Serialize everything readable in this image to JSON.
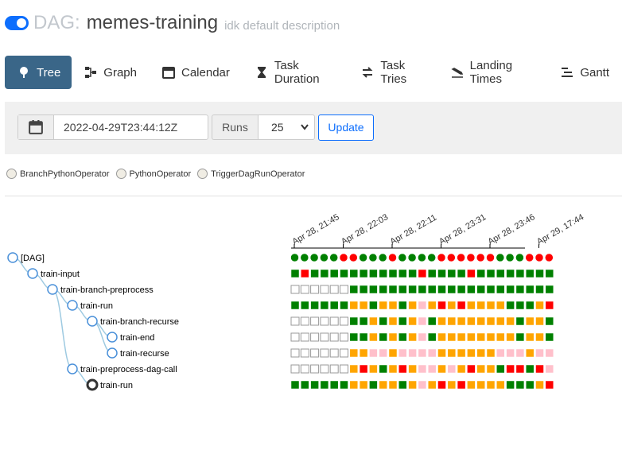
{
  "header": {
    "dag_prefix": "DAG:",
    "dag_id": "memes-training",
    "description": "idk default description",
    "toggle_on": true
  },
  "tabs": [
    {
      "label": "Tree",
      "icon": "tree-icon",
      "active": true
    },
    {
      "label": "Graph",
      "icon": "graph-icon"
    },
    {
      "label": "Calendar",
      "icon": "calendar-icon"
    },
    {
      "label": "Task Duration",
      "icon": "hourglass-icon"
    },
    {
      "label": "Task Tries",
      "icon": "retry-icon"
    },
    {
      "label": "Landing Times",
      "icon": "landing-icon"
    },
    {
      "label": "Gantt",
      "icon": "gantt-icon"
    }
  ],
  "toolbar": {
    "base_date": "2022-04-29T23:44:12Z",
    "runs_label": "Runs",
    "runs_value": "25",
    "update_label": "Update"
  },
  "legend": [
    "BranchPythonOperator",
    "PythonOperator",
    "TriggerDagRunOperator"
  ],
  "colors": {
    "success": "#008000",
    "failed": "#ff0000",
    "upstream_failed": "#ffa500",
    "skipped": "#ffc0cb",
    "none": "#ffffff",
    "accent": "#0d6efd",
    "active_tab": "#3a6688"
  },
  "run_dates": [
    "Apr 28, 21:45",
    "Apr 28, 22:03",
    "Apr 28, 22:11",
    "Apr 28, 23:31",
    "Apr 28, 23:46",
    "Apr 29, 17:44"
  ],
  "tree": [
    {
      "label": "[DAG]",
      "depth": 0
    },
    {
      "label": "train-input",
      "depth": 1
    },
    {
      "label": "train-branch-preprocess",
      "depth": 2
    },
    {
      "label": "train-run",
      "depth": 3
    },
    {
      "label": "train-branch-recurse",
      "depth": 4
    },
    {
      "label": "train-end",
      "depth": 5
    },
    {
      "label": "train-recurse",
      "depth": 5
    },
    {
      "label": "train-preprocess-dag-call",
      "depth": 3
    },
    {
      "label": "train-run",
      "depth": 4
    }
  ],
  "grid": {
    "dag_runs": "GGGGGRRGGGRGGGGRRRRRRGGGRRR",
    "rows": [
      "GRGGGGGGGGGGGRGGGGRGGGGGGGG",
      "NNNNNNGGGGGGGGGGGGGGGGGGGGG",
      "GGGGGGOOGOOGOPOROROOOOGGGOR",
      "NNNNNNGGOGOGOPGOOOOOOOOGOOG",
      "NNNNNNGGOGOGOPGOOOOOOOOGOOG",
      "NNNNNNOOPPOPPPPOOOOOOPPPOPP",
      "NNNNNNOROGOROPPOPOROOGRRGRP",
      "GGGGGGOOGOOGOPOROROOOOGGGOR"
    ]
  }
}
